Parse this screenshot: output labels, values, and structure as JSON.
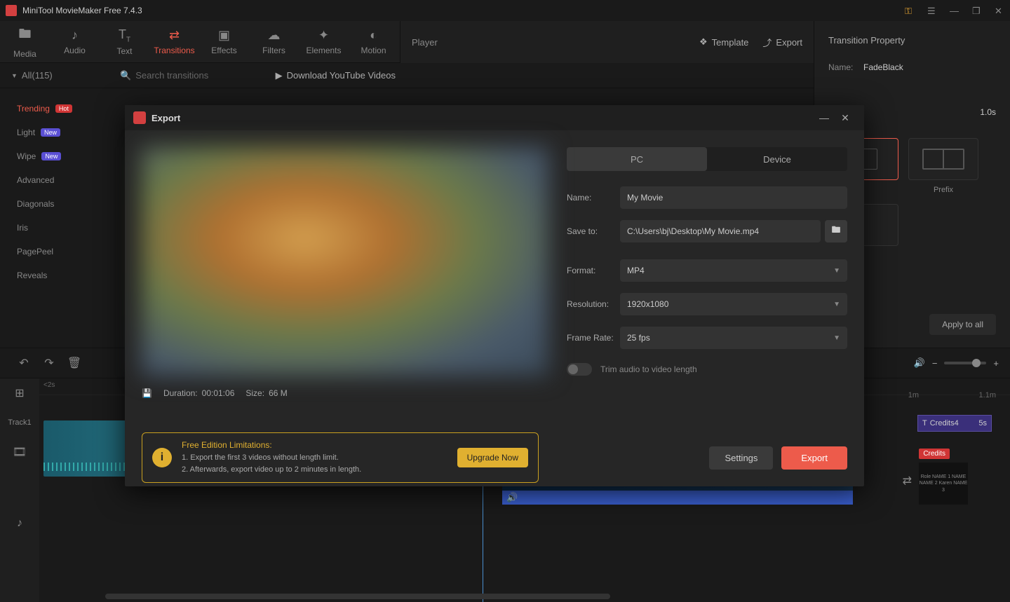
{
  "titlebar": {
    "title": "MiniTool MovieMaker Free 7.4.3"
  },
  "toolbar": {
    "media": "Media",
    "audio": "Audio",
    "text": "Text",
    "transitions": "Transitions",
    "effects": "Effects",
    "filters": "Filters",
    "elements": "Elements",
    "motion": "Motion"
  },
  "secondary": {
    "all": "All(115)",
    "search_placeholder": "Search transitions",
    "youtube": "Download YouTube Videos"
  },
  "sidebar": {
    "trending": "Trending",
    "light": "Light",
    "wipe": "Wipe",
    "advanced": "Advanced",
    "diagonals": "Diagonals",
    "iris": "Iris",
    "pagepeel": "PagePeel",
    "reveals": "Reveals",
    "badges": {
      "hot": "Hot",
      "new": "New"
    }
  },
  "player": {
    "label": "Player",
    "template": "Template",
    "export": "Export"
  },
  "property": {
    "title": "Transition Property",
    "name_label": "Name:",
    "name_value": "FadeBlack",
    "duration_value": "1.0s",
    "prefix_label": "Prefix",
    "apply": "Apply to all"
  },
  "timeline": {
    "track1": "Track1",
    "time_2s": "<2s",
    "mark_1m": "1m",
    "mark_11m": "1.1m",
    "credits_clip": "Credits4",
    "credits_time": "5s",
    "credits_tag": "Credits",
    "credits_thumb": "Role NAME 1\nNAME NAME 2\nKaren NAME 3"
  },
  "export_dialog": {
    "title": "Export",
    "tabs": {
      "pc": "PC",
      "device": "Device"
    },
    "form": {
      "name_label": "Name:",
      "name_value": "My Movie",
      "saveto_label": "Save to:",
      "saveto_value": "C:\\Users\\bj\\Desktop\\My Movie.mp4",
      "format_label": "Format:",
      "format_value": "MP4",
      "resolution_label": "Resolution:",
      "resolution_value": "1920x1080",
      "framerate_label": "Frame Rate:",
      "framerate_value": "25 fps",
      "trim_label": "Trim audio to video length"
    },
    "info": {
      "duration_label": "Duration:",
      "duration_value": "00:01:06",
      "size_label": "Size:",
      "size_value": "66 M"
    },
    "limitations": {
      "title": "Free Edition Limitations:",
      "line1": "1. Export the first 3 videos without length limit.",
      "line2": "2. Afterwards, export video up to 2 minutes in length.",
      "upgrade": "Upgrade Now"
    },
    "buttons": {
      "settings": "Settings",
      "export": "Export"
    }
  }
}
